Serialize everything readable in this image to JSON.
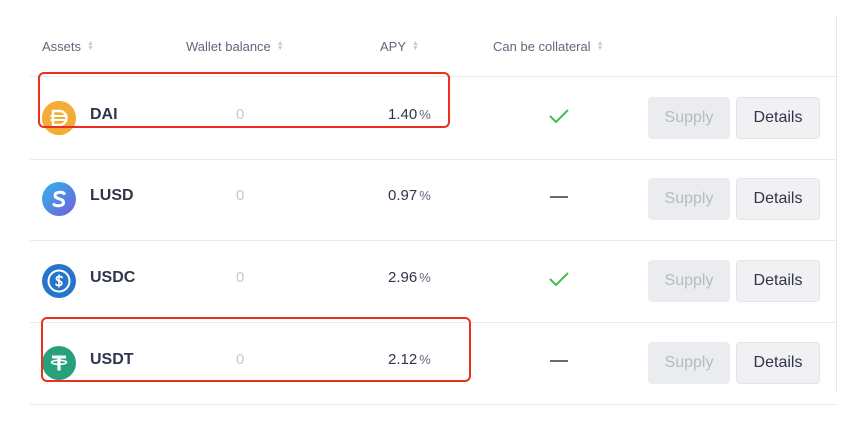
{
  "header": {
    "assets": "Assets",
    "wallet_balance": "Wallet balance",
    "apy": "APY",
    "collateral": "Can be collateral"
  },
  "rows": [
    {
      "name": "DAI",
      "balance": "0",
      "apy": "1.40",
      "apy_unit": "%",
      "collateral": "check",
      "supply": "Supply",
      "details": "Details",
      "icon": "dai-icon",
      "color": "#f5ac37"
    },
    {
      "name": "LUSD",
      "balance": "0",
      "apy": "0.97",
      "apy_unit": "%",
      "collateral": "dash",
      "supply": "Supply",
      "details": "Details",
      "icon": "lusd-icon",
      "color": "#745ddf"
    },
    {
      "name": "USDC",
      "balance": "0",
      "apy": "2.96",
      "apy_unit": "%",
      "collateral": "check",
      "supply": "Supply",
      "details": "Details",
      "icon": "usdc-icon",
      "color": "#2775ca"
    },
    {
      "name": "USDT",
      "balance": "0",
      "apy": "2.12",
      "apy_unit": "%",
      "collateral": "dash",
      "supply": "Supply",
      "details": "Details",
      "icon": "usdt-icon",
      "color": "#26a17b"
    }
  ],
  "colors": {
    "check": "#46bc4b",
    "highlight": "#e8321f"
  }
}
